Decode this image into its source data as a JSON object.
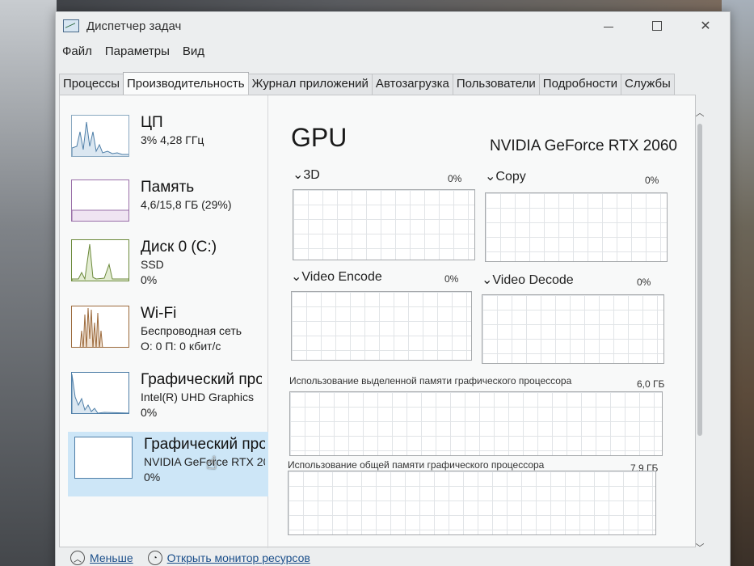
{
  "window": {
    "title": "Диспетчер задач",
    "controls": {
      "minimize": "—",
      "maximize": "☐",
      "close": "✕"
    }
  },
  "menu": [
    "Файл",
    "Параметры",
    "Вид"
  ],
  "tabs": [
    {
      "label": "Процессы",
      "active": false
    },
    {
      "label": "Производительность",
      "active": true
    },
    {
      "label": "Журнал приложений",
      "active": false
    },
    {
      "label": "Автозагрузка",
      "active": false
    },
    {
      "label": "Пользователи",
      "active": false
    },
    {
      "label": "Подробности",
      "active": false
    },
    {
      "label": "Службы",
      "active": false
    }
  ],
  "sidebar": {
    "items": [
      {
        "title": "ЦП",
        "sub1": "3% 4,28 ГГц",
        "sub2": ""
      },
      {
        "title": "Память",
        "sub1": "4,6/15,8 ГБ (29%)",
        "sub2": ""
      },
      {
        "title": "Диск 0 (C:)",
        "sub1": "SSD",
        "sub2": "0%"
      },
      {
        "title": "Wi-Fi",
        "sub1": "Беспроводная сеть",
        "sub2": "О: 0 П: 0 кбит/с"
      },
      {
        "title": "Графический про",
        "sub1": "Intel(R) UHD Graphics",
        "sub2": "0%"
      },
      {
        "title": "Графический про",
        "sub1": "NVIDIA GeForce RTX 20",
        "sub2": "0%"
      }
    ]
  },
  "gpu": {
    "title": "GPU",
    "model": "NVIDIA GeForce RTX 2060",
    "graphs": [
      {
        "label": "3D",
        "pct": "0%"
      },
      {
        "label": "Copy",
        "pct": "0%"
      },
      {
        "label": "Video Encode",
        "pct": "0%"
      },
      {
        "label": "Video Decode",
        "pct": "0%"
      }
    ],
    "dedicated_mem": {
      "label": "Использование выделенной памяти графического процессора",
      "value": "6,0 ГБ"
    },
    "shared_mem": {
      "label": "Использование общей памяти графического процессора",
      "value": "7,9 ГБ"
    }
  },
  "footer": {
    "less_label": "Меньше",
    "resmon_label": "Открыть монитор ресурсов"
  },
  "colors": {
    "selected_bg": "#cde6f7",
    "cpu": "#4f7fa8",
    "memory": "#9a6fa8",
    "disk": "#6c8a3c",
    "wifi": "#9c6a3c"
  }
}
